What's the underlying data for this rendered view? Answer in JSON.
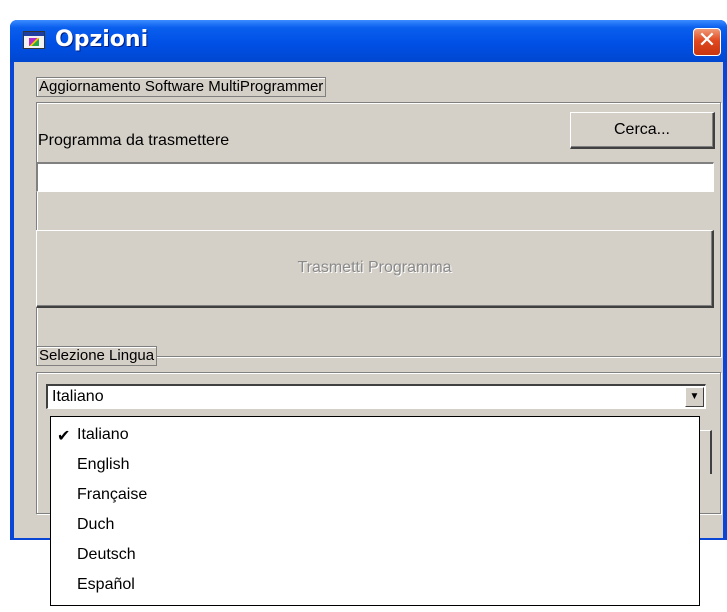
{
  "window": {
    "title": "Opzioni",
    "close_glyph": "✕"
  },
  "update_group": {
    "legend": "Aggiornamento Software MultiProgrammer",
    "program_label": "Programma da trasmettere",
    "browse_button": "Cerca...",
    "program_path": "",
    "transmit_button": "Trasmetti Programma"
  },
  "language_group": {
    "legend": "Selezione Lingua",
    "selected": "Italiano",
    "arrow_glyph": "▼",
    "options": [
      {
        "label": "Italiano",
        "check": "✔"
      },
      {
        "label": "English",
        "check": ""
      },
      {
        "label": "Française",
        "check": ""
      },
      {
        "label": "Duch",
        "check": ""
      },
      {
        "label": "Deutsch",
        "check": ""
      },
      {
        "label": "Español",
        "check": ""
      }
    ]
  },
  "icons": {
    "app": "app-window-icon",
    "close": "close-icon",
    "dropdown": "chevron-down-icon",
    "check": "check-icon"
  },
  "colors": {
    "titlebar": "#0050e6",
    "client": "#d4d0c8",
    "close": "#e0481f"
  }
}
